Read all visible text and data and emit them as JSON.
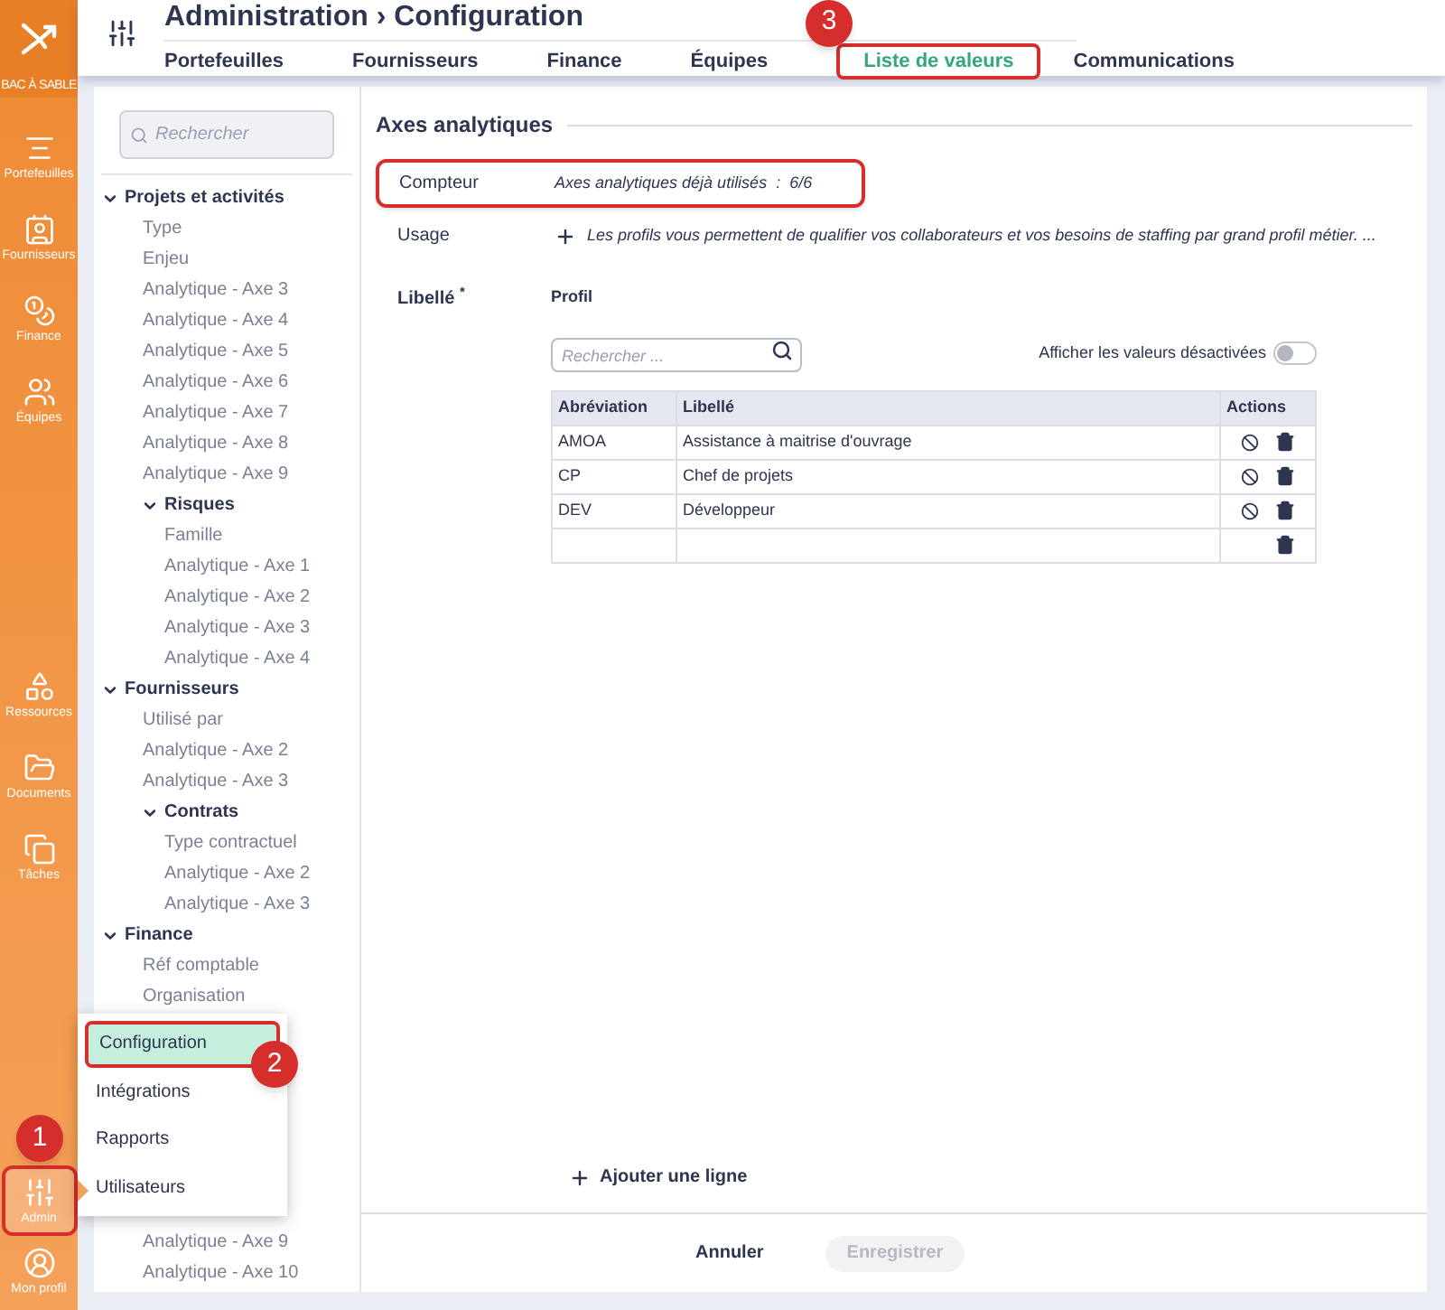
{
  "rail": {
    "env_label": "BAC À SABLE",
    "top_items": [
      {
        "label": "Portefeuilles",
        "selected": false
      },
      {
        "label": "Fournisseurs",
        "selected": false
      },
      {
        "label": "Finance",
        "selected": false
      },
      {
        "label": "Équipes",
        "selected": false
      }
    ],
    "middle_items": [
      {
        "label": "Ressources",
        "selected": false
      },
      {
        "label": "Documents",
        "selected": false
      },
      {
        "label": "Tâches",
        "selected": false
      }
    ],
    "bottom_items": [
      {
        "label": "Admin",
        "selected": true,
        "annotation": "1"
      },
      {
        "label": "Mon profil",
        "selected": false
      }
    ]
  },
  "header": {
    "title": "Administration › Configuration",
    "tabs": [
      {
        "label": "Portefeuilles",
        "selected": false
      },
      {
        "label": "Fournisseurs",
        "selected": false
      },
      {
        "label": "Finance",
        "selected": false
      },
      {
        "label": "Équipes",
        "selected": false
      },
      {
        "label": "Liste de valeurs",
        "selected": true,
        "annotation": "3"
      },
      {
        "label": "Communications",
        "selected": false
      }
    ]
  },
  "tree": {
    "search_placeholder": "Rechercher",
    "items": [
      {
        "label": "Projets et activités",
        "expanded": true,
        "children": [
          {
            "label": "Type"
          },
          {
            "label": "Enjeu"
          },
          {
            "label": "Analytique - Axe 3"
          },
          {
            "label": "Analytique - Axe 4"
          },
          {
            "label": "Analytique - Axe 5"
          },
          {
            "label": "Analytique - Axe 6"
          },
          {
            "label": "Analytique - Axe 7"
          },
          {
            "label": "Analytique - Axe 8"
          },
          {
            "label": "Analytique - Axe 9"
          },
          {
            "label": "Risques",
            "expanded": true,
            "children": [
              {
                "label": "Famille"
              },
              {
                "label": "Analytique - Axe 1"
              },
              {
                "label": "Analytique - Axe 2"
              },
              {
                "label": "Analytique - Axe 3"
              },
              {
                "label": "Analytique - Axe 4"
              }
            ]
          }
        ]
      },
      {
        "label": "Fournisseurs",
        "expanded": true,
        "children": [
          {
            "label": "Utilisé par"
          },
          {
            "label": "Analytique - Axe 2"
          },
          {
            "label": "Analytique - Axe 3"
          },
          {
            "label": "Contrats",
            "expanded": true,
            "children": [
              {
                "label": "Type contractuel"
              },
              {
                "label": "Analytique - Axe 2"
              },
              {
                "label": "Analytique - Axe 3"
              }
            ]
          }
        ]
      },
      {
        "label": "Finance",
        "expanded": true,
        "children": [
          {
            "label": "Réf comptable"
          },
          {
            "label": "Organisation"
          }
        ]
      }
    ],
    "lower_items": [
      {
        "label": "Analytique - Axe 9"
      },
      {
        "label": "Analytique - Axe 10"
      }
    ]
  },
  "admin_menu": [
    {
      "label": "Configuration",
      "selected": true,
      "annotation": "2"
    },
    {
      "label": "Intégrations",
      "selected": false
    },
    {
      "label": "Rapports",
      "selected": false
    },
    {
      "label": "Utilisateurs",
      "selected": false
    }
  ],
  "section": {
    "title": "Axes analytiques",
    "counter": {
      "label": "Compteur",
      "value": "Axes analytiques déjà utilisés  :  6/6",
      "highlighted": true
    },
    "usage": {
      "label": "Usage",
      "text": "Les profils vous permettent de qualifier vos collaborateurs et vos besoins de staffing par grand profil métier. ..."
    },
    "libelle": {
      "label": "Libellé",
      "required_mark": "*",
      "list_title": "Profil",
      "search_placeholder": "Rechercher ...",
      "toggle_label": "Afficher les valeurs désactivées",
      "toggle_on": false,
      "columns": [
        "Abréviation",
        "Libellé",
        "Actions"
      ],
      "rows": [
        {
          "kind": "value",
          "abbreviation": "AMOA",
          "label": "Assistance à maitrise d'ouvrage"
        },
        {
          "kind": "value",
          "abbreviation": "CP",
          "label": "Chef de projets"
        },
        {
          "kind": "value",
          "abbreviation": "DEV",
          "label": "Développeur"
        },
        {
          "kind": "empty"
        }
      ]
    },
    "add_row": "Ajouter une ligne"
  },
  "footer": {
    "cancel": "Annuler",
    "save": "Enregistrer",
    "save_disabled": true
  }
}
